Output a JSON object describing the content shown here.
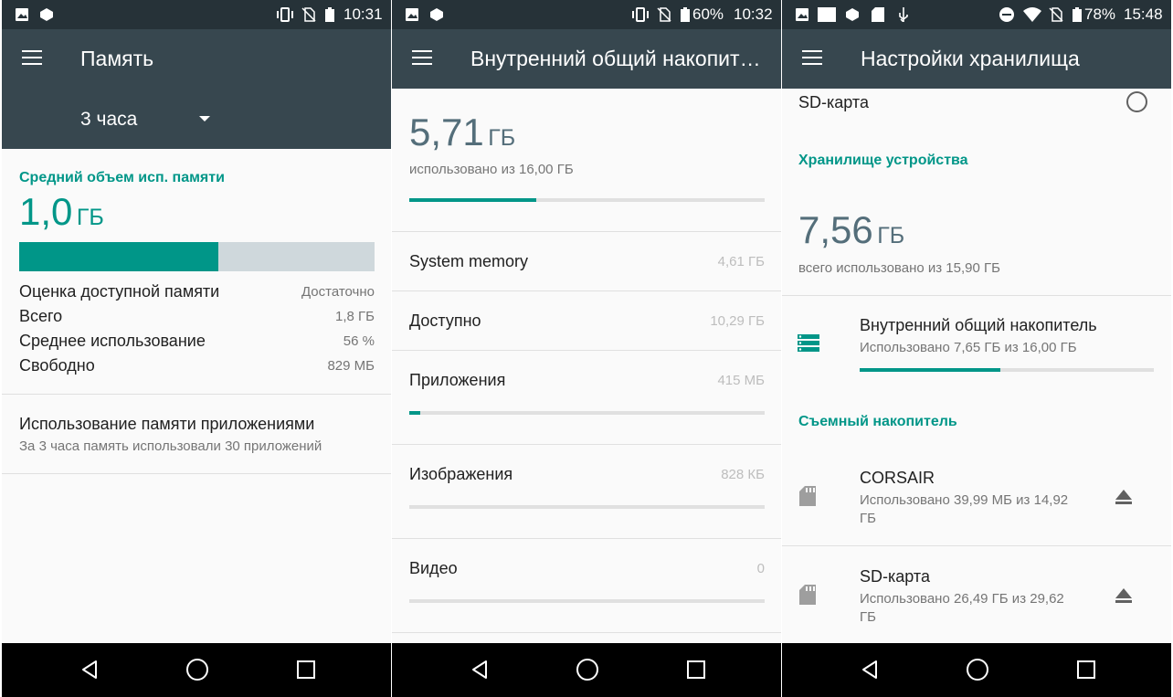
{
  "colors": {
    "status_bar": "#263238",
    "app_bar": "#37474f",
    "accent": "#009688",
    "track": "#cfd8dc",
    "nav_bar": "#000000"
  },
  "p1": {
    "status": {
      "time": "10:31",
      "icons": [
        "gallery-icon",
        "app-icon",
        "vibrate-icon",
        "no-sim-icon",
        "battery-icon"
      ]
    },
    "title": "Память",
    "period": "3 часа",
    "avg_label": "Средний объем исп. памяти",
    "avg_value": "1,0",
    "avg_unit": "ГБ",
    "usage_fraction": 0.56,
    "stats": [
      {
        "label": "Оценка доступной памяти",
        "value": "Достаточно"
      },
      {
        "label": "Всего",
        "value": "1,8 ГБ"
      },
      {
        "label": "Среднее использование",
        "value": "56 %"
      },
      {
        "label": "Свободно",
        "value": "829 МБ"
      }
    ],
    "apps_title": "Использование памяти приложениями",
    "apps_sub": "За 3 часа память использовали 30 приложений"
  },
  "p2": {
    "status": {
      "time": "10:32",
      "battery": "60%"
    },
    "title": "Внутренний общий накопит…",
    "used_value": "5,71",
    "used_unit": "ГБ",
    "used_sub": "использовано из 16,00 ГБ",
    "used_fraction": 0.357,
    "rows": [
      {
        "label": "System memory",
        "value": "4,61 ГБ",
        "fraction": null
      },
      {
        "label": "Доступно",
        "value": "10,29 ГБ",
        "fraction": null
      },
      {
        "label": "Приложения",
        "value": "415 МБ",
        "fraction": 0.03
      },
      {
        "label": "Изображения",
        "value": "828 КБ",
        "fraction": 0.0
      },
      {
        "label": "Видео",
        "value": "0",
        "fraction": 0.0
      }
    ]
  },
  "p3": {
    "status": {
      "time": "15:48",
      "battery": "78%"
    },
    "title": "Настройки хранилища",
    "sd_top": "SD-карта",
    "device_header": "Хранилище устройства",
    "dev_value": "7,56",
    "dev_unit": "ГБ",
    "dev_sub": "всего использовано из 15,90 ГБ",
    "internal": {
      "name": "Внутренний общий накопитель",
      "sub": "Использовано 7,65 ГБ из 16,00 ГБ",
      "fraction": 0.478
    },
    "removable_header": "Съемный накопитель",
    "removables": [
      {
        "name": "CORSAIR",
        "sub": "Использовано 39,99 МБ из 14,92 ГБ"
      },
      {
        "name": "SD-карта",
        "sub": "Использовано 26,49 ГБ из 29,62 ГБ"
      }
    ]
  }
}
